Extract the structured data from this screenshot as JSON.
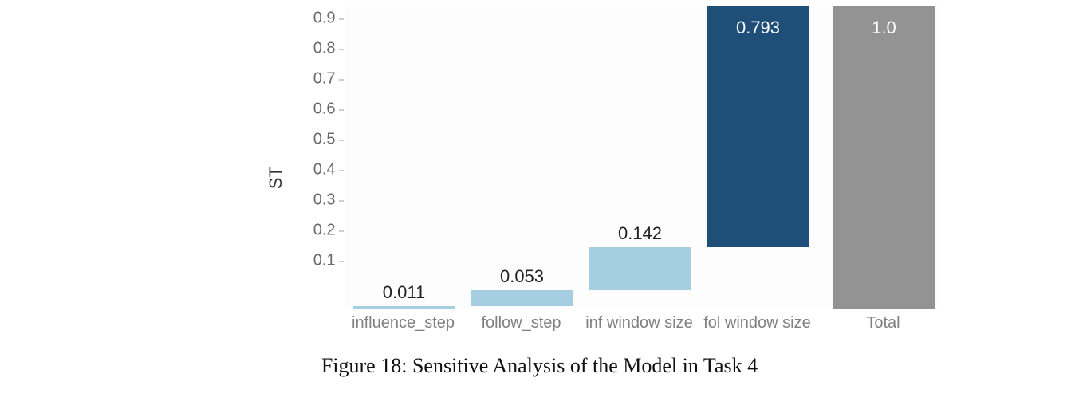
{
  "chart_data": {
    "type": "bar",
    "categories": [
      "influence_step",
      "follow_step",
      "inf window size",
      "fol window size",
      "Total"
    ],
    "values": [
      0.011,
      0.053,
      0.142,
      0.793,
      1.0
    ],
    "data_labels": [
      "0.011",
      "0.053",
      "0.142",
      "0.793",
      "1.0"
    ],
    "colors": [
      "#A6CEE3",
      "#A6CEE3",
      "#A6CEE3",
      "#1F4E79",
      "#939393"
    ],
    "is_waterfall": true,
    "ylabel": "ST",
    "xlabel": "",
    "title": "",
    "ylim": [
      0,
      1.0
    ],
    "y_ticks": [
      0.1,
      0.2,
      0.3,
      0.4,
      0.5,
      0.6,
      0.7,
      0.8,
      0.9
    ],
    "y_tick_labels": [
      "0.1",
      "0.2",
      "0.3",
      "0.4",
      "0.5",
      "0.6",
      "0.7",
      "0.8",
      "0.9"
    ]
  },
  "caption": "Figure 18: Sensitive Analysis of the Model in Task 4"
}
